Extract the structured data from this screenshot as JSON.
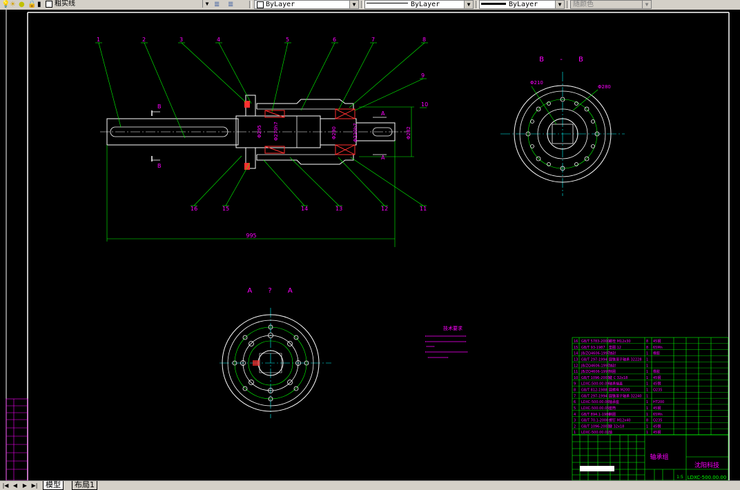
{
  "toolbar": {
    "layer_name": "粗实线",
    "color_value": "ByLayer",
    "linetype_value": "ByLayer",
    "lineweight_value": "ByLayer",
    "plotstyle_value": "随颜色"
  },
  "drawing": {
    "main_dimension": "995",
    "section_bb_title": "B - B",
    "section_aa_title": "A ? A",
    "section_mark_b": "B",
    "section_mark_a": "A",
    "dims_main": [
      "Φ295",
      "Φ270h7",
      "Φ290",
      "Φ220h7",
      "Φ282"
    ],
    "dims_bb": [
      "Φ210",
      "Φ280"
    ],
    "balloons_top": [
      "1",
      "2",
      "3",
      "4",
      "5",
      "6",
      "7",
      "8",
      "9",
      "10"
    ],
    "balloons_bottom": [
      "16",
      "15",
      "14",
      "13",
      "12",
      "11"
    ],
    "tech_requirements_title": "技术要求"
  },
  "title_block": {
    "rows": [
      {
        "no": "16",
        "code": "GB/T 5783-2000",
        "name": "螺栓 M12x30",
        "qty": "8",
        "material": "45钢"
      },
      {
        "no": "15",
        "code": "GB/T 93-1987",
        "name": "垫圈 12",
        "qty": "8",
        "material": "65Mn"
      },
      {
        "no": "14",
        "code": "JB/ZQ4606-1997",
        "name": "油封",
        "qty": "1",
        "material": "橡胶"
      },
      {
        "no": "13",
        "code": "GB/T 297-1994",
        "name": "圆锥滚子轴承 32228",
        "qty": "1",
        "material": ""
      },
      {
        "no": "12",
        "code": "JB/ZQ4606-1997",
        "name": "油封",
        "qty": "1",
        "material": ""
      },
      {
        "no": "11",
        "code": "JB/ZQ4606-1997",
        "name": "挡圈",
        "qty": "1",
        "material": "橡胶"
      },
      {
        "no": "10",
        "code": "GB/T 1096-2003",
        "name": "键 C 32x18",
        "qty": "1",
        "material": "45钢"
      },
      {
        "no": "9",
        "code": "LDXC-500.00.09",
        "name": "轴承端盖",
        "qty": "1",
        "material": "45钢"
      },
      {
        "no": "8",
        "code": "GB/T 812-1988",
        "name": "圆螺母 M200",
        "qty": "1",
        "material": "Q235"
      },
      {
        "no": "7",
        "code": "GB/T 297-1994",
        "name": "圆锥滚子轴承 32240",
        "qty": "1",
        "material": ""
      },
      {
        "no": "6",
        "code": "LDXC-500.00.06",
        "name": "轴承座",
        "qty": "1",
        "material": "HT200"
      },
      {
        "no": "5",
        "code": "LDXC-500.00.05",
        "name": "套筒",
        "qty": "1",
        "material": "45钢"
      },
      {
        "no": "4",
        "code": "GB/T 894.1-1986",
        "name": "挡圈",
        "qty": "1",
        "material": "65Mn"
      },
      {
        "no": "3",
        "code": "GB/T 70.1-2000",
        "name": "螺钉 M12x40",
        "qty": "8",
        "material": "Q235"
      },
      {
        "no": "2",
        "code": "GB/T 1096-2003",
        "name": "键 32x18",
        "qty": "1",
        "material": "45钢"
      },
      {
        "no": "1",
        "code": "LDXC-500.00.01",
        "name": "轴",
        "qty": "1",
        "material": "45钢"
      }
    ],
    "part_name": "轴承组",
    "company": "沈阳科技",
    "drawing_number": "LDXC-500.00.00",
    "scale": "1:5"
  },
  "layout_tabs": [
    "模型",
    "布局1"
  ]
}
